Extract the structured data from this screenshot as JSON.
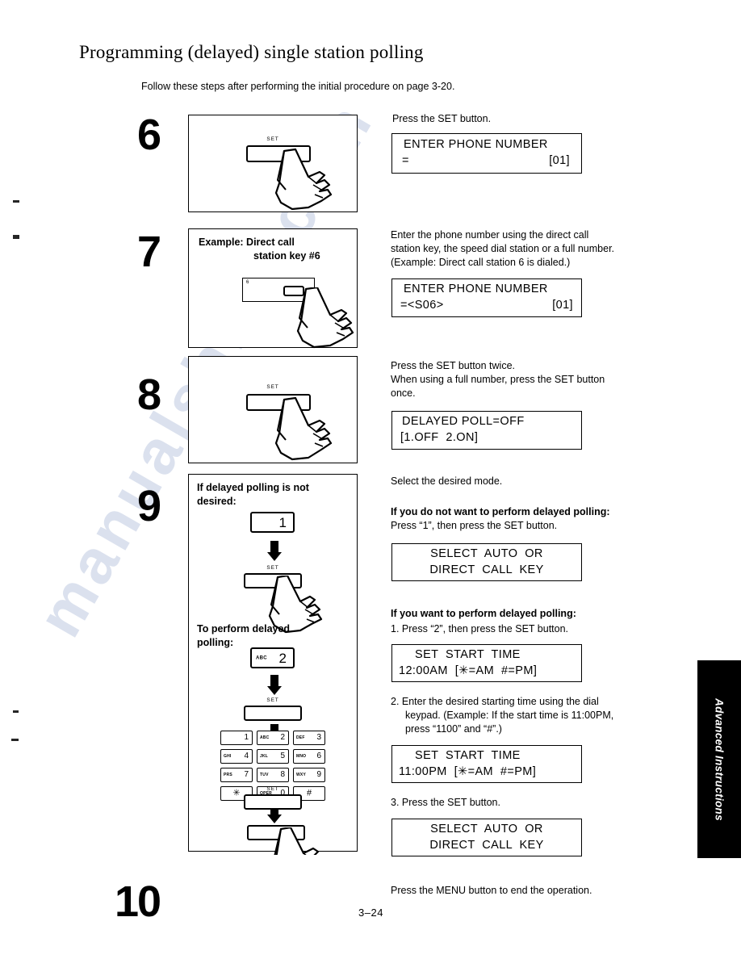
{
  "page": {
    "title": "Programming (delayed) single station polling",
    "intro": "Follow these steps after performing the initial procedure on page 3-20.",
    "footer_page_number": "3–24",
    "side_tab_label": "Advanced Instructions",
    "watermark_text": "manualshine.com"
  },
  "steps": [
    {
      "number": "6",
      "illustration": {
        "type": "set-button-press",
        "key_label": "SET"
      },
      "instructions": [
        "Press the SET button."
      ],
      "display": {
        "line1": "ENTER PHONE NUMBER",
        "line2_left": "=",
        "line2_right": "[01]"
      }
    },
    {
      "number": "7",
      "illustration": {
        "type": "direct-call-station-key",
        "caption_line1": "Example:  Direct call",
        "caption_line2": "station key #6",
        "station_number": "6"
      },
      "instructions": [
        "Enter the phone number using the direct call",
        "station key, the speed dial station or a full number.",
        "(Example:  Direct call station 6 is dialed.)"
      ],
      "display": {
        "line1": "ENTER PHONE NUMBER",
        "line2_left": "=<S06>",
        "line2_right": "[01]"
      }
    },
    {
      "number": "8",
      "illustration": {
        "type": "set-button-press",
        "key_label": "SET"
      },
      "instructions": [
        "Press the SET button twice.",
        "When using a full number, press the SET button",
        "once."
      ],
      "display": {
        "line1": "DELAYED POLL=OFF",
        "line2_left": "[1.OFF  2.ON]",
        "line2_right": ""
      }
    },
    {
      "number": "9",
      "illustration": {
        "type": "delayed-polling-flow",
        "caption_a_line1": "If delayed polling is not",
        "caption_a_line2": "desired:",
        "key_a_digit": "1",
        "key_a_alpha": "",
        "set_label_1": "SET",
        "caption_b_line1": "To perform delayed",
        "caption_b_line2": "polling:",
        "key_b_digit": "2",
        "key_b_alpha": "ABC",
        "set_label_2": "SET",
        "set_label_3": "SET",
        "keypad": [
          [
            {
              "digit": "1",
              "alpha": ""
            },
            {
              "digit": "2",
              "alpha": "ABC"
            },
            {
              "digit": "3",
              "alpha": "DEF"
            }
          ],
          [
            {
              "digit": "4",
              "alpha": "GHI"
            },
            {
              "digit": "5",
              "alpha": "JKL"
            },
            {
              "digit": "6",
              "alpha": "MNO"
            }
          ],
          [
            {
              "digit": "7",
              "alpha": "PRS"
            },
            {
              "digit": "8",
              "alpha": "TUV"
            },
            {
              "digit": "9",
              "alpha": "WXY"
            }
          ],
          [
            {
              "digit": "✳",
              "alpha": "",
              "center": true
            },
            {
              "digit": "0",
              "alpha": "OPER"
            },
            {
              "digit": "#",
              "alpha": "",
              "center": true
            }
          ]
        ]
      },
      "lead_instruction": "Select the desired mode.",
      "branch_no": {
        "heading": "If you do not want to perform delayed polling:",
        "body": "Press “1”, then press the SET button.",
        "display": {
          "line1": "SELECT  AUTO  OR",
          "line2": "DIRECT  CALL  KEY"
        }
      },
      "branch_yes": {
        "heading": "If you want to perform delayed polling:",
        "item1": "1.  Press “2”, then press the SET button.",
        "display1": {
          "line1": "SET  START  TIME",
          "line2": "12:00AM  [✳=AM  #=PM]"
        },
        "item2_lines": [
          "2.  Enter the desired starting time using the dial",
          "keypad. (Example:  If the start time is 11:00PM,",
          "press “1100” and “#”.)"
        ],
        "display2": {
          "line1": "SET  START  TIME",
          "line2": "11:00PM  [✳=AM  #=PM]"
        },
        "item3": "3.  Press the SET button.",
        "display3": {
          "line1": "SELECT  AUTO  OR",
          "line2": "DIRECT  CALL  KEY"
        }
      }
    },
    {
      "number": "10",
      "instructions": [
        "Press the MENU button to end the operation."
      ]
    }
  ]
}
